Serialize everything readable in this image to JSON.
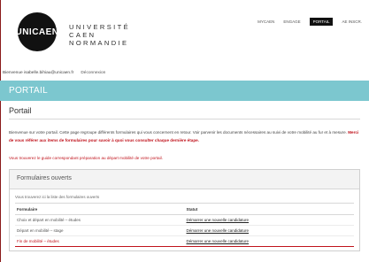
{
  "colors": {
    "accent_band": "#7cc7cf",
    "alert_red": "#c0131c",
    "dark": "#111111"
  },
  "brand": {
    "logo_mark": "UNICAEN",
    "name_lines": [
      "UNIVERSITÉ",
      "CAEN",
      "NORMANDIE"
    ]
  },
  "topnav": {
    "items": [
      "MYCAEN",
      "ENGAGE",
      "PORTAIL",
      "AE INSCR."
    ],
    "active_index": 2
  },
  "user": {
    "greeting": "Bienvenue isabelle.bihiau@unicaen.fr",
    "logout_label": "Déconnexion"
  },
  "bandeau": {
    "title": "PORTAIL"
  },
  "page": {
    "title": "Portail",
    "intro_text": "Bienvenue sur votre portail. Cette page regroupe différents formulaires qui vous concernent en retour. Voir parvenir les documents nécessaires au suivi de votre mobilité au fur et à mesure.",
    "intro_emphasis": "Merci de vous référer aux items de formulaires pour savoir à quoi vous consulter chaque dernière étape.",
    "notice": "Vous trouverez le guide correspondant préparation au départ mobilité de votre portail."
  },
  "forms_panel": {
    "title": "Formulaires ouverts",
    "subtitle": "Vous trouverez ici la liste des formulaires ouverts",
    "columns": [
      "Formulaire",
      "Statut"
    ],
    "rows": [
      {
        "form": "Choix et départ en mobilité – études",
        "status": "Démarrer une nouvelle candidature",
        "form_red": false
      },
      {
        "form": "Départ en mobilité – stage",
        "status": "Démarrer une nouvelle candidature",
        "form_red": false
      },
      {
        "form": "Fin de mobilité – études",
        "status": "Démarrer une nouvelle candidature",
        "form_red": true
      }
    ]
  }
}
